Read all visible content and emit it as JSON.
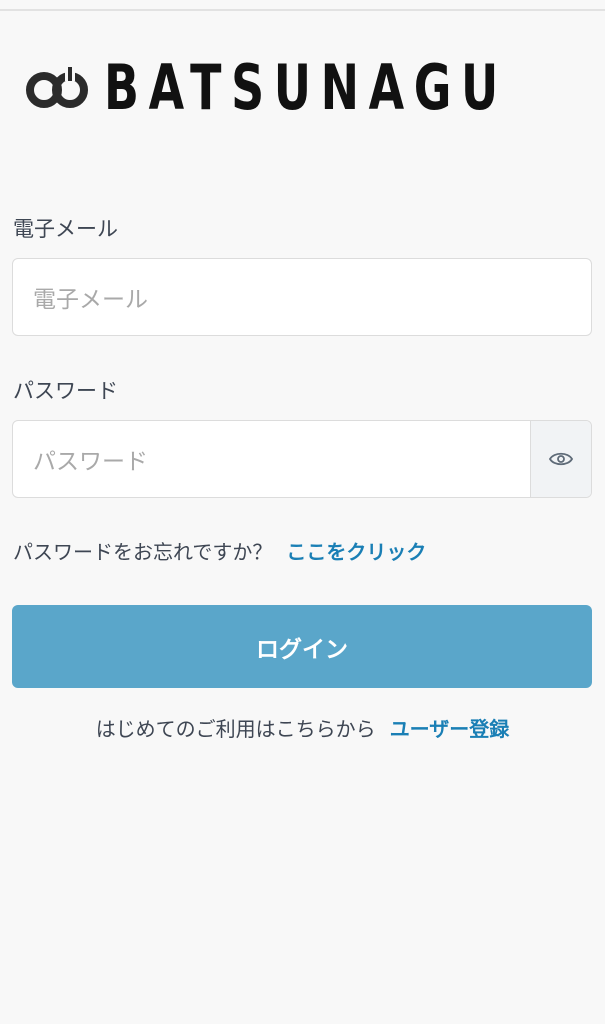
{
  "app": {
    "logo_text": "BATSUNAGU"
  },
  "form": {
    "email": {
      "label": "電子メール",
      "placeholder": "電子メール",
      "value": ""
    },
    "password": {
      "label": "パスワード",
      "placeholder": "パスワード",
      "value": "",
      "toggle_icon": "eye-icon"
    },
    "forgot": {
      "text": "パスワードをお忘れですか？",
      "link": "ここをクリック"
    },
    "login_button": "ログイン",
    "register": {
      "text": "はじめてのご利用はこちらから",
      "link": "ユーザー登録"
    }
  },
  "colors": {
    "primary": "#5aa6ca",
    "link": "#1a7fb5",
    "background": "#f8f8f8"
  }
}
